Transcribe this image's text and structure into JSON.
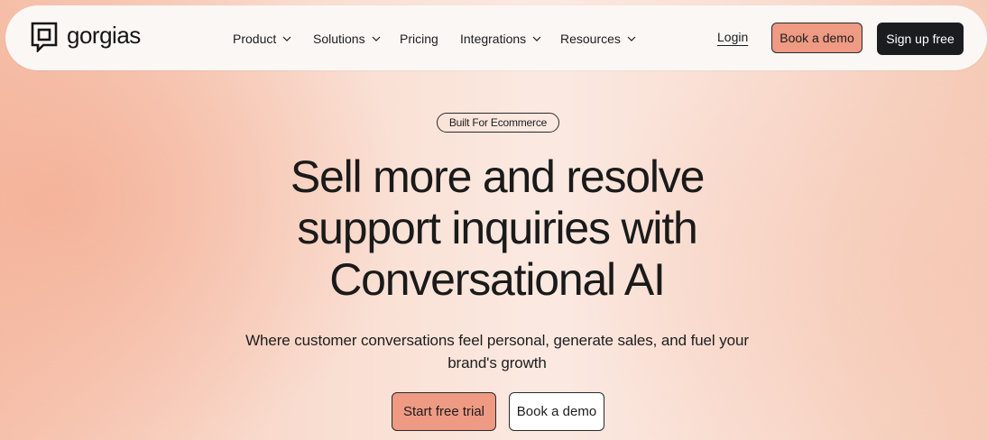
{
  "brand": {
    "name": "gorgias",
    "logo_icon": "gorgias-chat-square-icon"
  },
  "nav": {
    "items": [
      {
        "label": "Product",
        "has_dropdown": true
      },
      {
        "label": "Solutions",
        "has_dropdown": true
      },
      {
        "label": "Pricing",
        "has_dropdown": false
      },
      {
        "label": "Integrations",
        "has_dropdown": true
      },
      {
        "label": "Resources",
        "has_dropdown": true
      }
    ],
    "login_label": "Login",
    "book_demo_label": "Book a demo",
    "signup_label": "Sign up free"
  },
  "hero": {
    "badge": "Built For Ecommerce",
    "headline_lines": [
      "Sell more and resolve",
      "support inquiries with",
      "Conversational AI"
    ],
    "subtext": "Where customer conversations feel personal, generate sales, and fuel your brand's growth",
    "primary_cta": "Start free trial",
    "secondary_cta": "Book a demo"
  },
  "colors": {
    "accent": "#ef9a83",
    "dark": "#1b1c1f",
    "nav_bg": "#fbf7f5"
  }
}
